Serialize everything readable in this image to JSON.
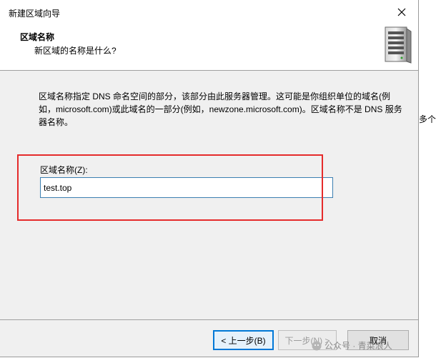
{
  "window": {
    "title": "新建区域向导"
  },
  "header": {
    "title": "区域名称",
    "subtitle": "新区域的名称是什么?"
  },
  "body": {
    "description": "区域名称指定 DNS 命名空间的部分，该部分由此服务器管理。这可能是你组织单位的域名(例如，microsoft.com)或此域名的一部分(例如，newzone.microsoft.com)。区域名称不是 DNS 服务器名称。",
    "zone_name_label": "区域名称(Z):",
    "zone_name_value": "test.top"
  },
  "buttons": {
    "back": "< 上一步(B)",
    "next": "下一步(N) >",
    "cancel": "取消"
  },
  "background": {
    "fragment_text": "多个"
  },
  "watermark": {
    "text": "公众号 · 青菜浪人"
  },
  "colors": {
    "highlight": "#e52b2b",
    "accent": "#0078d7"
  }
}
